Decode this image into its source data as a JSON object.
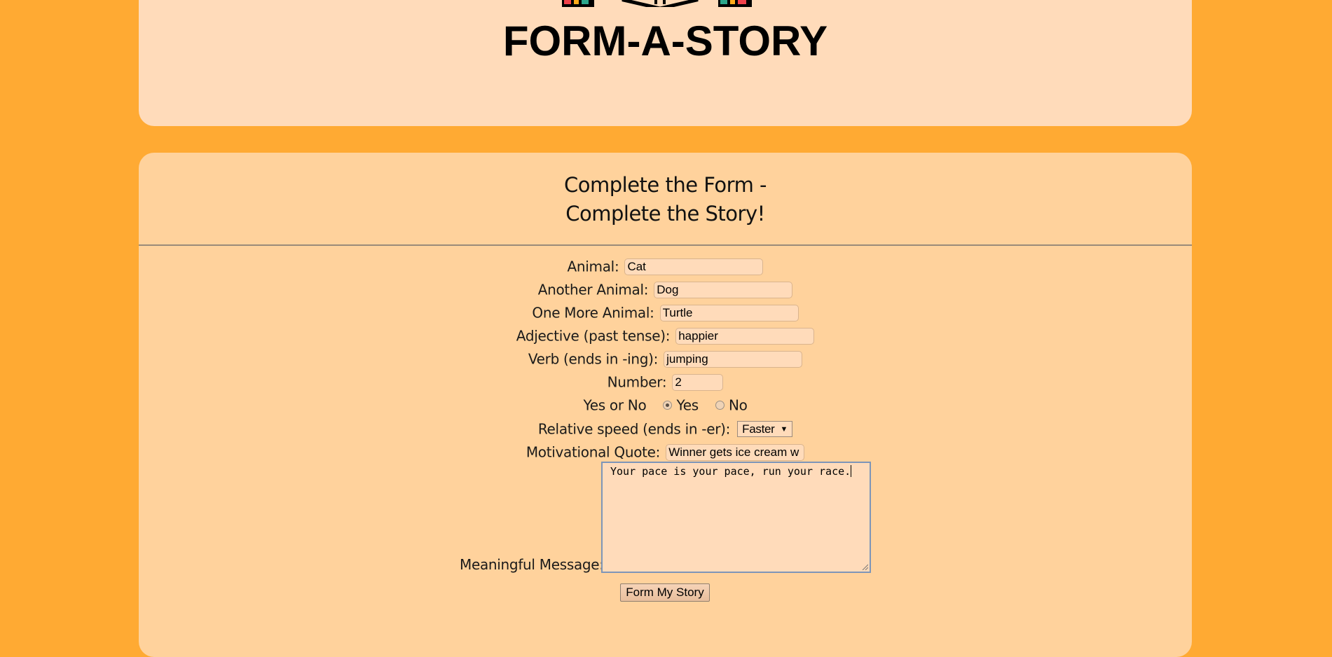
{
  "header": {
    "site_title": "FORM-A-STORY",
    "logo_colors": {
      "red": "#F0424B",
      "yellow": "#FFAA1A",
      "teal": "#2BA68B",
      "outline": "#000000"
    }
  },
  "form": {
    "heading_line1": "Complete the Form -",
    "heading_line2": "Complete the Story!",
    "fields": {
      "animal": {
        "label": "Animal:",
        "value": "Cat"
      },
      "another_animal": {
        "label": "Another Animal:",
        "value": "Dog"
      },
      "one_more_animal": {
        "label": "One More Animal:",
        "value": "Turtle"
      },
      "adjective": {
        "label": "Adjective (past tense):",
        "value": "happier"
      },
      "verb": {
        "label": "Verb (ends in -ing):",
        "value": "jumping"
      },
      "number": {
        "label": "Number:",
        "value": "2"
      },
      "yes_no": {
        "label": "Yes or No",
        "options": [
          "Yes",
          "No"
        ],
        "selected": "Yes"
      },
      "relative_speed": {
        "label": "Relative speed (ends in -er):",
        "selected": "Faster"
      },
      "motivational_quote": {
        "label": "Motivational Quote:",
        "value": "Winner gets ice cream w"
      },
      "meaningful_message": {
        "label": "Meaningful Message:",
        "value": "Your pace is your pace, run your race."
      }
    },
    "submit_label": "Form My Story"
  },
  "colors": {
    "page_background": "#FFAA33",
    "header_card": "#FFDBBA",
    "form_card": "#FFD29C",
    "input_background": "#FFDBBA",
    "textarea_focus_border": "#7D95B8"
  }
}
